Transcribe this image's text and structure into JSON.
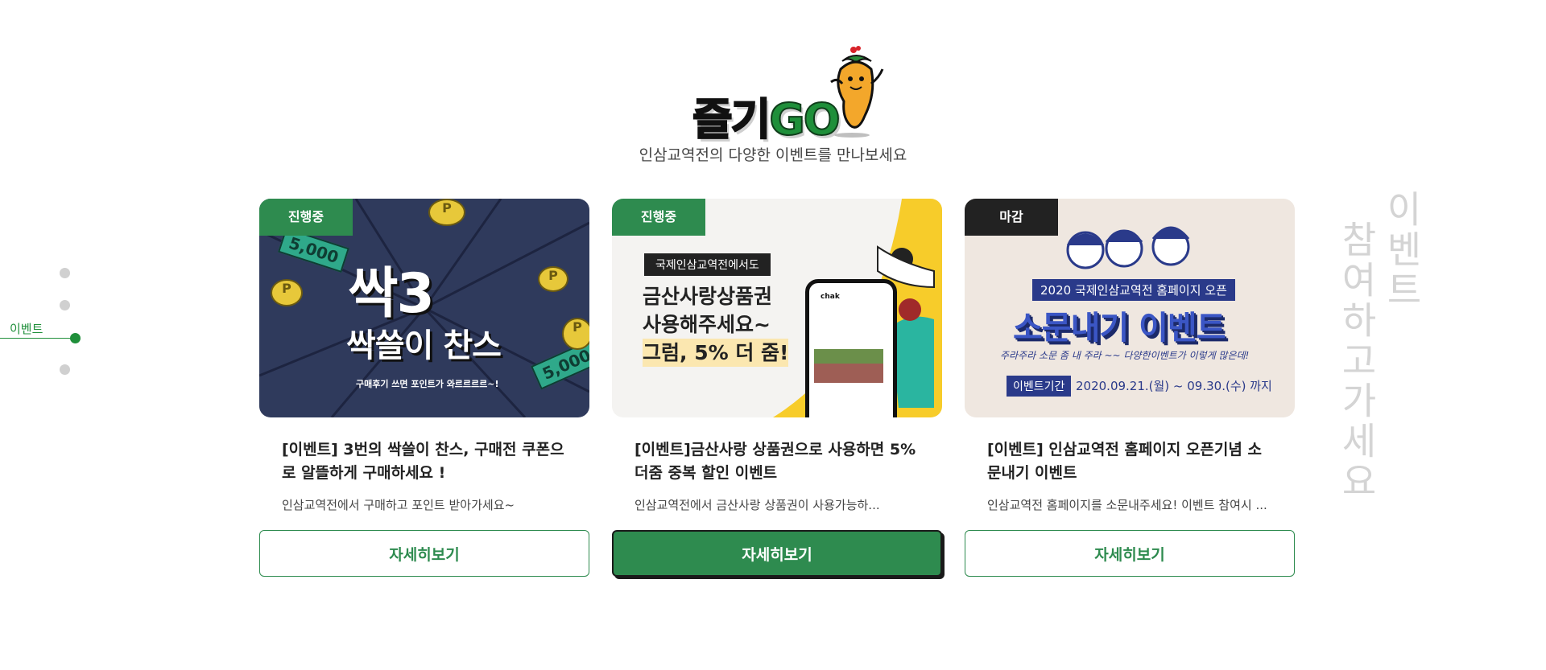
{
  "header": {
    "logo_text_kr": "즐기",
    "logo_text_go": "GO",
    "subtitle": "인삼교역전의 다양한 이벤트를 만나보세요"
  },
  "side_nav": {
    "active_label": "이벤트"
  },
  "decor": {
    "col1": "이벤트",
    "col2": "참여하고가세요"
  },
  "cards": [
    {
      "badge": "진행중",
      "image": {
        "title_main": "싹3",
        "title_sub": "싹쓸이 찬스",
        "caption": "구매후기 쓰면 포인트가 와르르르르~!",
        "money_label": "5,000"
      },
      "title": "[이벤트] 3번의 싹쓸이 찬스, 구매전 쿠폰으로 알뜰하게 구매하세요 !",
      "desc": "인삼교역전에서 구매하고 포인트 받아가세요~",
      "button": "자세히보기"
    },
    {
      "badge": "진행중",
      "image": {
        "sub_box": "국제인삼교역전에서도",
        "line1": "금산사랑상품권",
        "line2": "사용해주세요~",
        "line3": "그럼, 5% 더 줌!",
        "phone_brand": "chak"
      },
      "title": "[이벤트]금산사랑 상품권으로 사용하면  5% 더줌 중복 할인 이벤트",
      "desc": "인삼교역전에서 금산사랑 상품권이 사용가능하...",
      "button": "자세히보기"
    },
    {
      "badge": "마감",
      "image": {
        "small_title": "2020 국제인삼교역전 홈페이지 오픈",
        "big": "소문내기 이벤트",
        "script": "주라주라 소문 좀 내 주라 ~~ 다양한이벤트가 이렇게 많은데!",
        "period_label": "이벤트기간",
        "period": "2020.09.21.(월) ~ 09.30.(수) 까지"
      },
      "title": "[이벤트] 인삼교역전 홈페이지 오픈기념 소문내기 이벤트",
      "desc": "인삼교역전 홈페이지를 소문내주세요! 이벤트 참여시 ...",
      "button": "자세히보기"
    }
  ],
  "colors": {
    "accent": "#2e8b4f",
    "closed": "#222222"
  }
}
